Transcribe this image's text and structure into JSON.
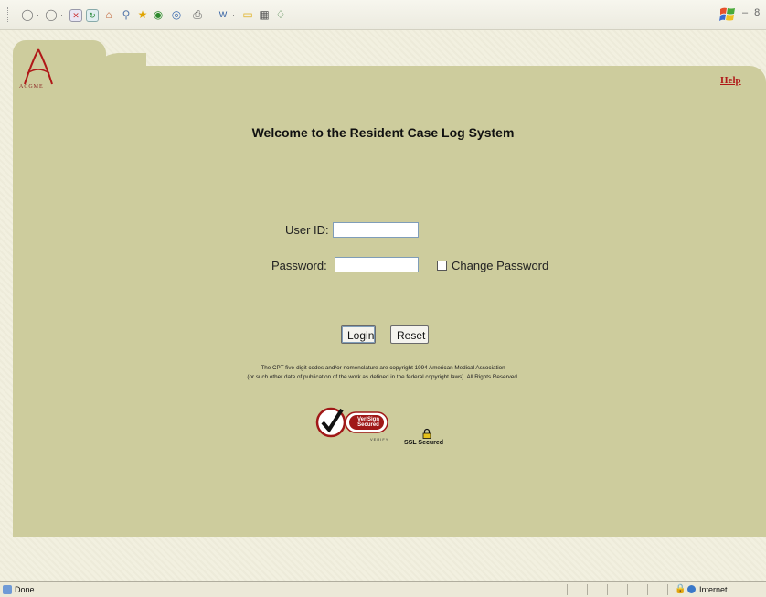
{
  "browser": {
    "toolbar_icons": [
      "back-icon",
      "forward-icon",
      "stop-icon",
      "refresh-icon",
      "home-icon",
      "search-icon",
      "favorites-icon",
      "media-icon",
      "history-icon",
      "print-icon",
      "edit-icon",
      "discuss-icon",
      "messenger-icon",
      "research-icon"
    ],
    "status": {
      "text": "Done",
      "zone": "Internet"
    }
  },
  "page": {
    "logo_text": "ACGME",
    "help_label": "Help",
    "title": "Welcome to the Resident Case Log System",
    "form": {
      "user_id_label": "User ID:",
      "user_id_value": "",
      "password_label": "Password:",
      "password_value": "",
      "change_password_label": "Change Password",
      "change_password_checked": false,
      "login_label": "Login",
      "reset_label": "Reset"
    },
    "copyright_line1": "The CPT five-digit codes and/or nomenclature are copyright 1994 American Medical Association",
    "copyright_line2": "(or such other date of publication of the work as defined in the federal copyright laws). All Rights Reserved.",
    "verisign": {
      "line1": "VeriSign",
      "line2": "Secured",
      "verify": "VERIFY"
    },
    "ssl_text": "SSL Secured"
  },
  "colors": {
    "panel": "#cdcc9d",
    "accent": "#b01818",
    "background": "#f2f0e0"
  }
}
